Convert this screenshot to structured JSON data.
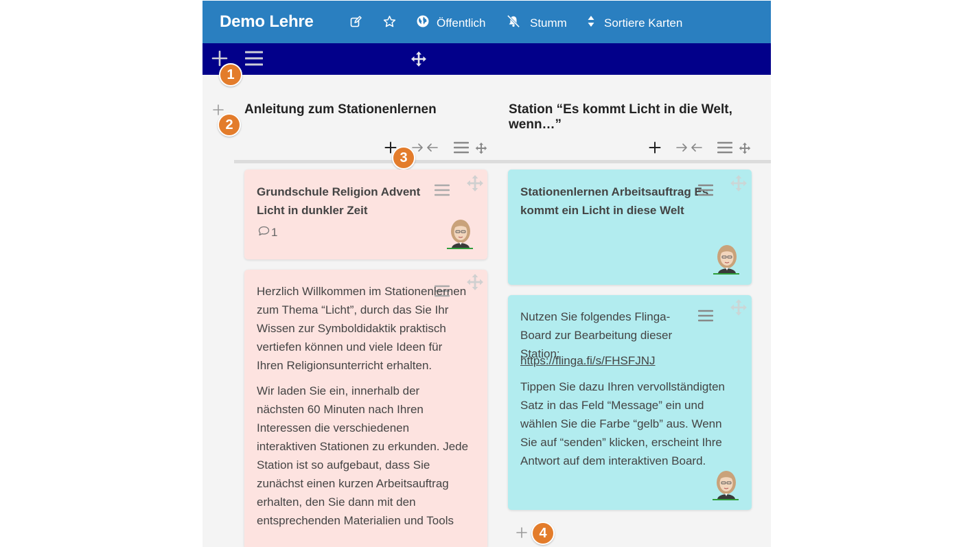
{
  "header": {
    "title": "Demo Lehre",
    "visibility_label": "Öffentlich",
    "mute_label": "Stumm",
    "sort_label": "Sortiere Karten"
  },
  "badges": [
    "1",
    "2",
    "3",
    "4"
  ],
  "columns": [
    {
      "title": "Anleitung zum Stationenlernen",
      "cards": [
        {
          "title": "Grundschule Religion Advent Licht in dunkler Zeit",
          "comments": "1"
        },
        {
          "paragraphs": [
            "Herzlich Willkommen im Stationenlernen zum Thema “Licht”, durch das Sie Ihr Wissen zur Symboldidaktik praktisch vertiefen können und viele Ideen für Ihren Religionsunterricht erhalten.",
            "Wir laden Sie ein, innerhalb der nächsten 60 Minuten nach Ihren Interessen die verschiedenen interaktiven Stationen zu erkunden. Jede Station ist so aufgebaut, dass Sie zunächst einen kurzen Arbeitsauftrag erhalten, den Sie dann mit den entsprechenden Materialien und Tools"
          ]
        }
      ]
    },
    {
      "title": "Station “Es kommt Licht in die Welt, wenn…”",
      "cards": [
        {
          "title": "Stationenlernen Arbeitsauftrag Es kommt ein Licht in diese Welt"
        },
        {
          "intro": "Nutzen Sie folgendes Flinga-Board zur Bearbeitung dieser Station:",
          "link": "https://flinga.fi/s/FHSFJNJ",
          "body": "Tippen Sie dazu Ihren vervollständigten Satz in das Feld “Message” ein und wählen Sie die Farbe “gelb” aus. Wenn Sie auf “senden” klicken, erscheint Ihre Antwort auf dem interaktiven Board."
        }
      ]
    }
  ],
  "icons": {
    "edit": "edit-icon",
    "star": "star-icon",
    "globe": "globe-icon",
    "mute": "bell-slash-icon",
    "sort": "sort-icon",
    "add": "plus-icon",
    "menu": "hamburger-icon",
    "move": "move-icon",
    "collapse": "collapse-arrows-icon",
    "comment": "comment-icon"
  },
  "colors": {
    "header": "#2a7fc0",
    "toolbar": "#02008a",
    "card_pink": "#fde3e0",
    "card_cyan": "#b2ecef",
    "badge": "#e37c2b",
    "background": "#f4f4f4"
  }
}
